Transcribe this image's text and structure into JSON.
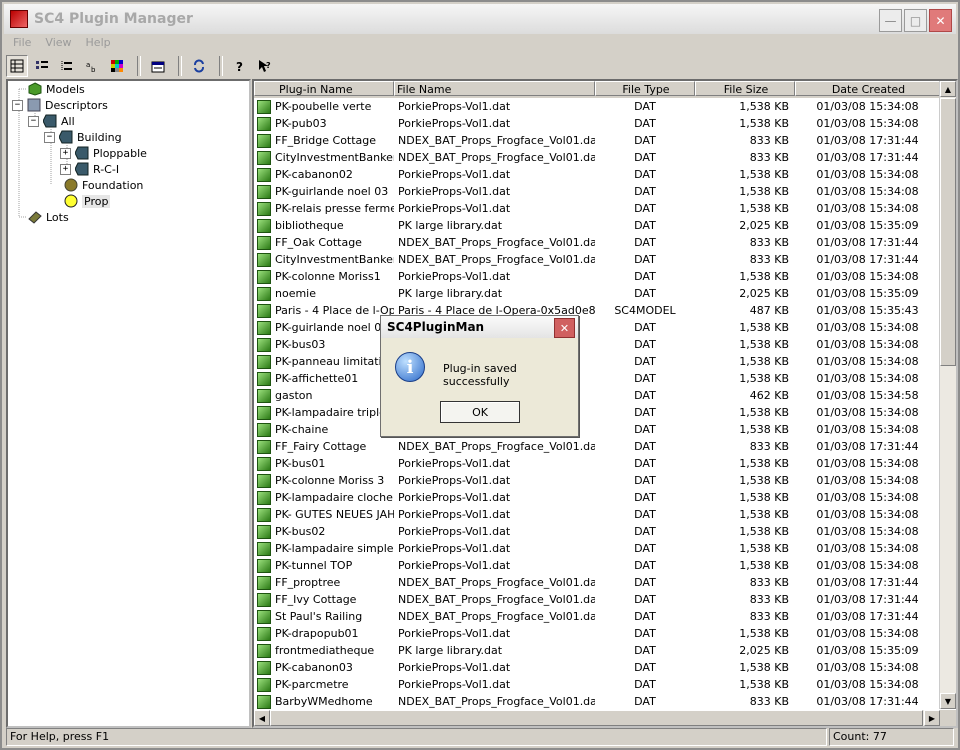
{
  "window": {
    "title": "SC4 Plugin Manager"
  },
  "menu": [
    "File",
    "View",
    "Help"
  ],
  "toolbar": {
    "icons": [
      "large-icons",
      "small-icons",
      "list",
      "details",
      "color-grid",
      "properties",
      "refresh",
      "help",
      "context-help"
    ]
  },
  "tree": [
    {
      "label": "Models",
      "icon": "models-icon"
    },
    {
      "label": "Descriptors",
      "icon": "descriptors-icon",
      "expander": "−"
    },
    {
      "label": "All",
      "icon": "folder-icon",
      "expander": "−"
    },
    {
      "label": "Building",
      "icon": "folder-icon",
      "expander": "−"
    },
    {
      "label": "Ploppable",
      "icon": "folder-icon",
      "expander": "+"
    },
    {
      "label": "R-C-I",
      "icon": "folder-icon",
      "expander": "+"
    },
    {
      "label": "Foundation",
      "icon": "foundation-icon"
    },
    {
      "label": "Prop",
      "icon": "prop-icon",
      "selected": true
    },
    {
      "label": "Lots",
      "icon": "lots-icon"
    }
  ],
  "columns": [
    "Plug-in Name",
    "File Name",
    "File Type",
    "File Size",
    "Date Created"
  ],
  "rows": [
    [
      "PK-poubelle verte",
      "PorkieProps-Vol1.dat",
      "DAT",
      "1,538 KB",
      "01/03/08 15:34:08"
    ],
    [
      "PK-pub03",
      "PorkieProps-Vol1.dat",
      "DAT",
      "1,538 KB",
      "01/03/08 15:34:08"
    ],
    [
      "FF_Bridge Cottage",
      "NDEX_BAT_Props_Frogface_Vol01.dat",
      "DAT",
      "833 KB",
      "01/03/08 17:31:44"
    ],
    [
      "CityInvestmentBanker2",
      "NDEX_BAT_Props_Frogface_Vol01.dat",
      "DAT",
      "833 KB",
      "01/03/08 17:31:44"
    ],
    [
      "PK-cabanon02",
      "PorkieProps-Vol1.dat",
      "DAT",
      "1,538 KB",
      "01/03/08 15:34:08"
    ],
    [
      "PK-guirlande noel 03",
      "PorkieProps-Vol1.dat",
      "DAT",
      "1,538 KB",
      "01/03/08 15:34:08"
    ],
    [
      "PK-relais presse ferme",
      "PorkieProps-Vol1.dat",
      "DAT",
      "1,538 KB",
      "01/03/08 15:34:08"
    ],
    [
      "bibliotheque",
      "PK large library.dat",
      "DAT",
      "2,025 KB",
      "01/03/08 15:35:09"
    ],
    [
      "FF_Oak Cottage",
      "NDEX_BAT_Props_Frogface_Vol01.dat",
      "DAT",
      "833 KB",
      "01/03/08 17:31:44"
    ],
    [
      "CityInvestmentBanker3",
      "NDEX_BAT_Props_Frogface_Vol01.dat",
      "DAT",
      "833 KB",
      "01/03/08 17:31:44"
    ],
    [
      "PK-colonne Moriss1",
      "PorkieProps-Vol1.dat",
      "DAT",
      "1,538 KB",
      "01/03/08 15:34:08"
    ],
    [
      "noemie",
      "PK large library.dat",
      "DAT",
      "2,025 KB",
      "01/03/08 15:35:09"
    ],
    [
      "Paris - 4 Place de l-Op...",
      "Paris - 4 Place de l-Opera-0x5ad0e8...",
      "SC4MODEL",
      "487 KB",
      "01/03/08 15:35:43"
    ],
    [
      "PK-guirlande noel 02",
      "",
      "DAT",
      "1,538 KB",
      "01/03/08 15:34:08"
    ],
    [
      "PK-bus03",
      "",
      "DAT",
      "1,538 KB",
      "01/03/08 15:34:08"
    ],
    [
      "PK-panneau limitation50",
      "",
      "DAT",
      "1,538 KB",
      "01/03/08 15:34:08"
    ],
    [
      "PK-affichette01",
      "",
      "DAT",
      "1,538 KB",
      "01/03/08 15:34:08"
    ],
    [
      "gaston",
      "",
      "DAT",
      "462 KB",
      "01/03/08 15:34:58"
    ],
    [
      "PK-lampadaire triple",
      "",
      "DAT",
      "1,538 KB",
      "01/03/08 15:34:08"
    ],
    [
      "PK-chaine",
      "",
      "DAT",
      "1,538 KB",
      "01/03/08 15:34:08"
    ],
    [
      "FF_Fairy Cottage",
      "NDEX_BAT_Props_Frogface_Vol01.dat",
      "DAT",
      "833 KB",
      "01/03/08 17:31:44"
    ],
    [
      "PK-bus01",
      "PorkieProps-Vol1.dat",
      "DAT",
      "1,538 KB",
      "01/03/08 15:34:08"
    ],
    [
      "PK-colonne Moriss 3",
      "PorkieProps-Vol1.dat",
      "DAT",
      "1,538 KB",
      "01/03/08 15:34:08"
    ],
    [
      "PK-lampadaire cloche ...",
      "PorkieProps-Vol1.dat",
      "DAT",
      "1,538 KB",
      "01/03/08 15:34:08"
    ],
    [
      "PK- GUTES NEUES JAHR",
      "PorkieProps-Vol1.dat",
      "DAT",
      "1,538 KB",
      "01/03/08 15:34:08"
    ],
    [
      "PK-bus02",
      "PorkieProps-Vol1.dat",
      "DAT",
      "1,538 KB",
      "01/03/08 15:34:08"
    ],
    [
      "PK-lampadaire simple",
      "PorkieProps-Vol1.dat",
      "DAT",
      "1,538 KB",
      "01/03/08 15:34:08"
    ],
    [
      "PK-tunnel TOP",
      "PorkieProps-Vol1.dat",
      "DAT",
      "1,538 KB",
      "01/03/08 15:34:08"
    ],
    [
      "FF_proptree",
      "NDEX_BAT_Props_Frogface_Vol01.dat",
      "DAT",
      "833 KB",
      "01/03/08 17:31:44"
    ],
    [
      "FF_Ivy Cottage",
      "NDEX_BAT_Props_Frogface_Vol01.dat",
      "DAT",
      "833 KB",
      "01/03/08 17:31:44"
    ],
    [
      "St Paul's Railing",
      "NDEX_BAT_Props_Frogface_Vol01.dat",
      "DAT",
      "833 KB",
      "01/03/08 17:31:44"
    ],
    [
      "PK-drapopub01",
      "PorkieProps-Vol1.dat",
      "DAT",
      "1,538 KB",
      "01/03/08 15:34:08"
    ],
    [
      "frontmediatheque",
      "PK large library.dat",
      "DAT",
      "2,025 KB",
      "01/03/08 15:35:09"
    ],
    [
      "PK-cabanon03",
      "PorkieProps-Vol1.dat",
      "DAT",
      "1,538 KB",
      "01/03/08 15:34:08"
    ],
    [
      "PK-parcmetre",
      "PorkieProps-Vol1.dat",
      "DAT",
      "1,538 KB",
      "01/03/08 15:34:08"
    ],
    [
      "BarbyWMedhome",
      "NDEX_BAT_Props_Frogface_Vol01.dat",
      "DAT",
      "833 KB",
      "01/03/08 17:31:44"
    ]
  ],
  "status": {
    "help": "For Help, press F1",
    "count": "Count: 77"
  },
  "dialog": {
    "title": "SC4PluginMan",
    "message": "Plug-in saved successfully",
    "ok": "OK",
    "icon": "info-icon"
  }
}
